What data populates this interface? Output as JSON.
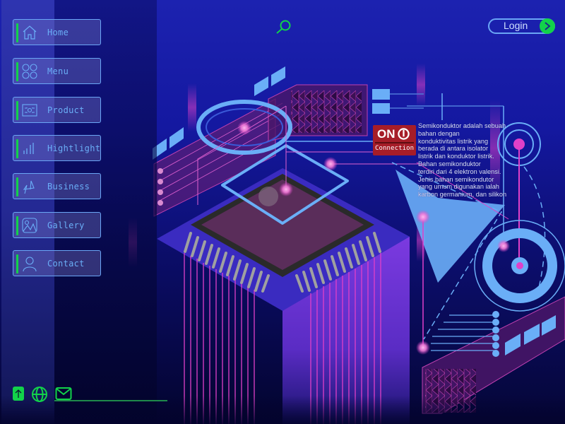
{
  "nav": {
    "items": [
      {
        "label": "Home",
        "icon": "home-icon"
      },
      {
        "label": "Menu",
        "icon": "grid-circles-icon"
      },
      {
        "label": "Product",
        "icon": "product-chip-icon"
      },
      {
        "label": "Hightlight",
        "icon": "bar-signal-icon"
      },
      {
        "label": "Business",
        "icon": "zigzag-chart-icon"
      },
      {
        "label": "Gallery",
        "icon": "image-icon"
      },
      {
        "label": "Contact",
        "icon": "user-icon"
      }
    ]
  },
  "header": {
    "search_icon": "search-icon",
    "login_label": "Login",
    "login_arrow": ">"
  },
  "status": {
    "on_label": "ON",
    "connection_label": "Connection"
  },
  "info": {
    "lines": [
      "Semikonduktor adalah sebuah",
      "bahan dengan",
      "konduktivitas listrik yang",
      "berada di antara isolator",
      "listrik dan konduktor listrik.",
      "Bahan semikonduktor",
      "terdiri dari 4 elektron valensi.",
      "Jenis bahan semikondutor",
      "yang umum digunakan ialah",
      "karbon germanium, dan silikon"
    ]
  },
  "footer": {
    "icons": [
      "upload-arrow-icon",
      "globe-icon",
      "mail-icon"
    ]
  },
  "colors": {
    "accent_green": "#12d24a",
    "accent_blue": "#6aa6f5",
    "accent_magenta": "#e040c8",
    "status_red": "#a61d28"
  }
}
